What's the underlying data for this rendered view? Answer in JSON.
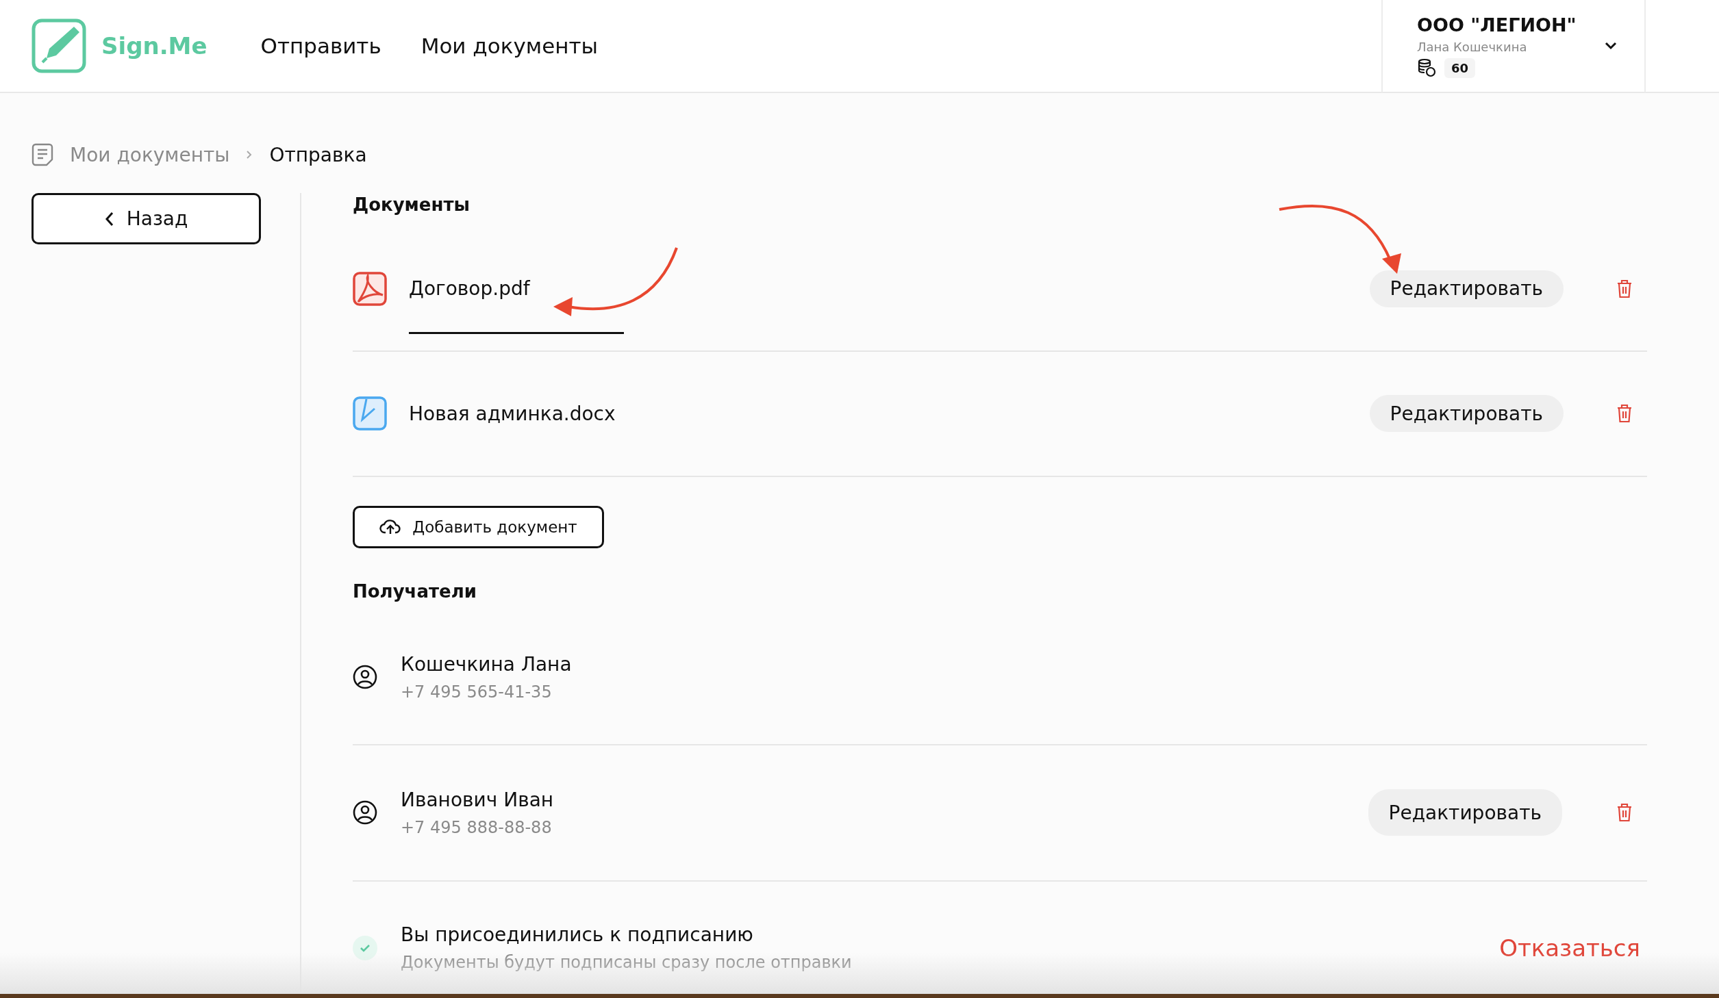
{
  "logo": {
    "text": "Sign.Me"
  },
  "nav": [
    {
      "label": "Отправить"
    },
    {
      "label": "Мои документы"
    }
  ],
  "account": {
    "org": "ООО \"ЛЕГИОН\"",
    "user": "Лана Кошечкина",
    "balance": "60"
  },
  "breadcrumb": [
    {
      "label": "Мои документы",
      "current": false
    },
    {
      "label": "Отправка",
      "current": true
    }
  ],
  "back_button": "Назад",
  "documents": {
    "title": "Документы",
    "items": [
      {
        "name": "Договор.pdf",
        "kind": "pdf",
        "edit": "Редактировать"
      },
      {
        "name": "Новая админка.docx",
        "kind": "docx",
        "edit": "Редактировать"
      }
    ],
    "add_button": "Добавить документ"
  },
  "recipients": {
    "title": "Получатели",
    "items": [
      {
        "name": "Кошечкина Лана",
        "phone": "+7 495 565-41-35"
      },
      {
        "name": "Иванович Иван",
        "phone": "+7 495 888-88-88",
        "edit": "Редактировать"
      }
    ]
  },
  "joined": {
    "title": "Вы присоединились к подписанию",
    "subtitle": "Документы будут подписаны сразу после отправки",
    "decline": "Отказаться"
  }
}
